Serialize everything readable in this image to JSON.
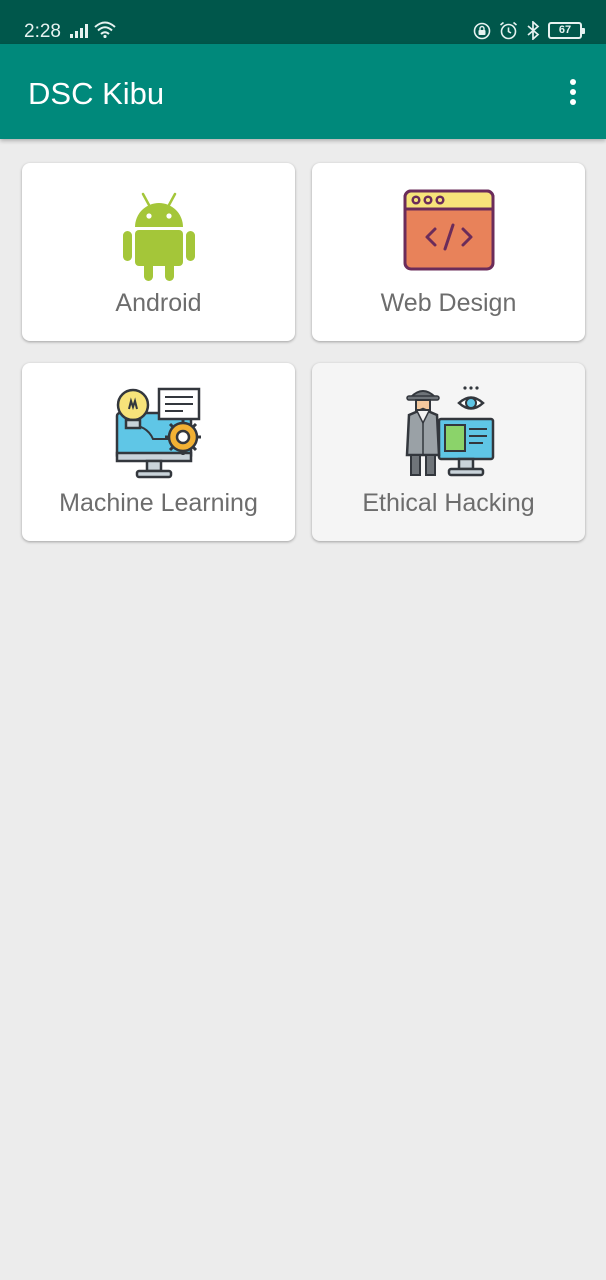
{
  "status_bar": {
    "time": "2:28",
    "battery_level": "67",
    "left_icons": [
      "signal-icon",
      "wifi-icon"
    ],
    "right_icons": [
      "lock-rotation-icon",
      "alarm-icon",
      "bluetooth-icon",
      "battery-icon"
    ]
  },
  "app_bar": {
    "title": "DSC Kibu",
    "menu_icon": "more-vert-icon"
  },
  "colors": {
    "status_bar": "#00574b",
    "app_bar": "#00897b",
    "background": "#ececec",
    "card": "#ffffff",
    "label": "#6d6d6d",
    "android_green": "#a4c639"
  },
  "categories": [
    {
      "label": "Android",
      "icon": "android-icon"
    },
    {
      "label": "Web Design",
      "icon": "web-code-icon"
    },
    {
      "label": "Machine Learning",
      "icon": "machine-learning-icon"
    },
    {
      "label": "Ethical Hacking",
      "icon": "hacker-icon"
    }
  ]
}
